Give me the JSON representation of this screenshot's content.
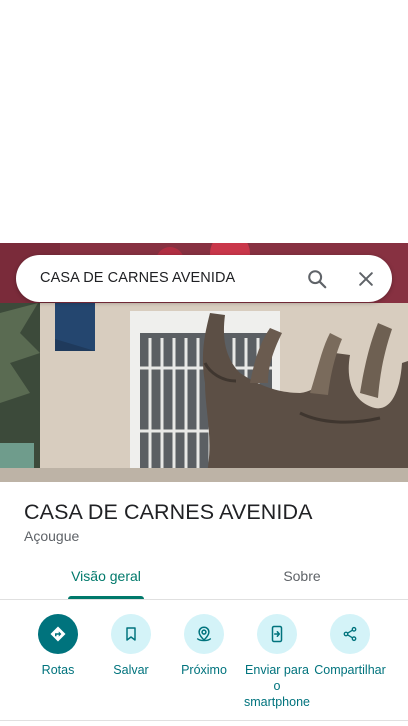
{
  "search": {
    "query": "CASA DE CARNES AVENIDA"
  },
  "place": {
    "name": "CASA DE CARNES AVENIDA",
    "category": "Açougue"
  },
  "tabs": [
    {
      "label": "Visão geral",
      "active": true
    },
    {
      "label": "Sobre",
      "active": false
    }
  ],
  "actions": [
    {
      "label": "Rotas",
      "icon": "directions-icon"
    },
    {
      "label": "Salvar",
      "icon": "bookmark-icon"
    },
    {
      "label": "Próximo",
      "icon": "nearby-icon"
    },
    {
      "label": "Enviar para o smartphone",
      "icon": "send-to-phone-icon"
    },
    {
      "label": "Compartilhar",
      "icon": "share-icon"
    }
  ],
  "colors": {
    "accent": "#00737d",
    "tab_active": "#00796b",
    "action_bg": "#d4f3f8"
  }
}
